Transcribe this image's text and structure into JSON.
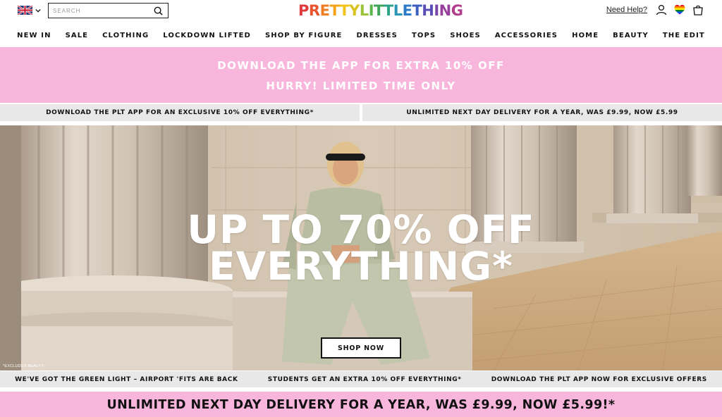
{
  "header": {
    "flag_icon": "uk-flag-icon",
    "search": {
      "placeholder": "SEARCH",
      "value": ""
    },
    "logo": {
      "letters": [
        "P",
        "R",
        "E",
        "T",
        "T",
        "Y",
        "L",
        "I",
        "T",
        "T",
        "L",
        "E",
        "T",
        "H",
        "I",
        "N",
        "G"
      ],
      "colors": [
        "#e03a3e",
        "#e8542e",
        "#ef7d22",
        "#f6a21b",
        "#f2c21a",
        "#d9c31f",
        "#9ac33b",
        "#5cb548",
        "#3ea55a",
        "#2ea38a",
        "#2a93b8",
        "#2c79c5",
        "#3d5fbf",
        "#5a4db5",
        "#7845a8",
        "#96409c",
        "#b13d8f"
      ]
    },
    "help_label": "Need Help?",
    "icons": [
      "user-icon",
      "heart-icon",
      "bag-icon"
    ]
  },
  "nav": {
    "items": [
      "NEW IN",
      "SALE",
      "CLOTHING",
      "LOCKDOWN LIFTED",
      "SHOP BY FIGURE",
      "DRESSES",
      "TOPS",
      "SHOES",
      "ACCESSORIES",
      "HOME",
      "BEAUTY",
      "THE EDIT"
    ]
  },
  "promo": {
    "line1": "DOWNLOAD THE APP FOR EXTRA 10% OFF",
    "line2": "HURRY! LIMITED TIME ONLY",
    "bg_color": "#f9b6dd"
  },
  "strips": {
    "left": "DOWNLOAD THE PLT APP FOR AN EXCLUSIVE 10% OFF EVERYTHING*",
    "right": "UNLIMITED NEXT DAY DELIVERY FOR A YEAR, WAS £9.99, NOW £5.99"
  },
  "hero": {
    "headline_line1": "UP TO 70% OFF",
    "headline_line2": "EVERYTHING*",
    "button_label": "SHOP NOW",
    "footnote": "*EXCLUDES BEAUTY"
  },
  "bottom_strip": {
    "items": [
      "WE'VE GOT THE GREEN LIGHT – AIRPORT 'FITS ARE BACK",
      "STUDENTS GET AN EXTRA 10% OFF EVERYTHING*",
      "DOWNLOAD THE PLT APP NOW FOR EXCLUSIVE OFFERS"
    ]
  },
  "bottom_banner": {
    "text": "UNLIMITED NEXT DAY DELIVERY FOR A YEAR, WAS £9.99, NOW £5.99!*"
  }
}
